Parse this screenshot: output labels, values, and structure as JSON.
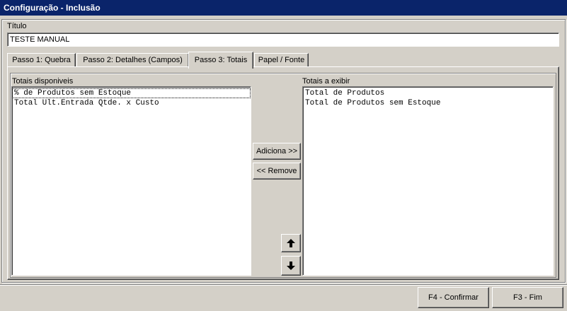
{
  "window": {
    "title": "Configuração - Inclusão"
  },
  "form": {
    "titulo_label": "Título",
    "titulo_value": "TESTE MANUAL"
  },
  "tabs": [
    {
      "label": "Passo 1: Quebra"
    },
    {
      "label": "Passo 2: Detalhes (Campos)"
    },
    {
      "label": "Passo 3: Totais"
    },
    {
      "label": "Papel / Fonte"
    }
  ],
  "totais": {
    "available_label": "Totais disponiveis",
    "available_items": [
      "% de Produtos sem Estoque",
      "Total Ult.Entrada Qtde. x Custo"
    ],
    "selected_label": "Totais a exibir",
    "selected_items": [
      "Total de Produtos",
      "Total de Produtos sem Estoque"
    ],
    "add_button": "Adiciona >>",
    "remove_button": "<< Remove",
    "move_up_icon": "arrow-up-icon",
    "move_down_icon": "arrow-down-icon"
  },
  "footer": {
    "confirm_button": "F4 - Confirmar",
    "end_button": "F3 - Fim"
  },
  "colors": {
    "titlebar": "#0a246a",
    "face": "#d4d0c8"
  }
}
